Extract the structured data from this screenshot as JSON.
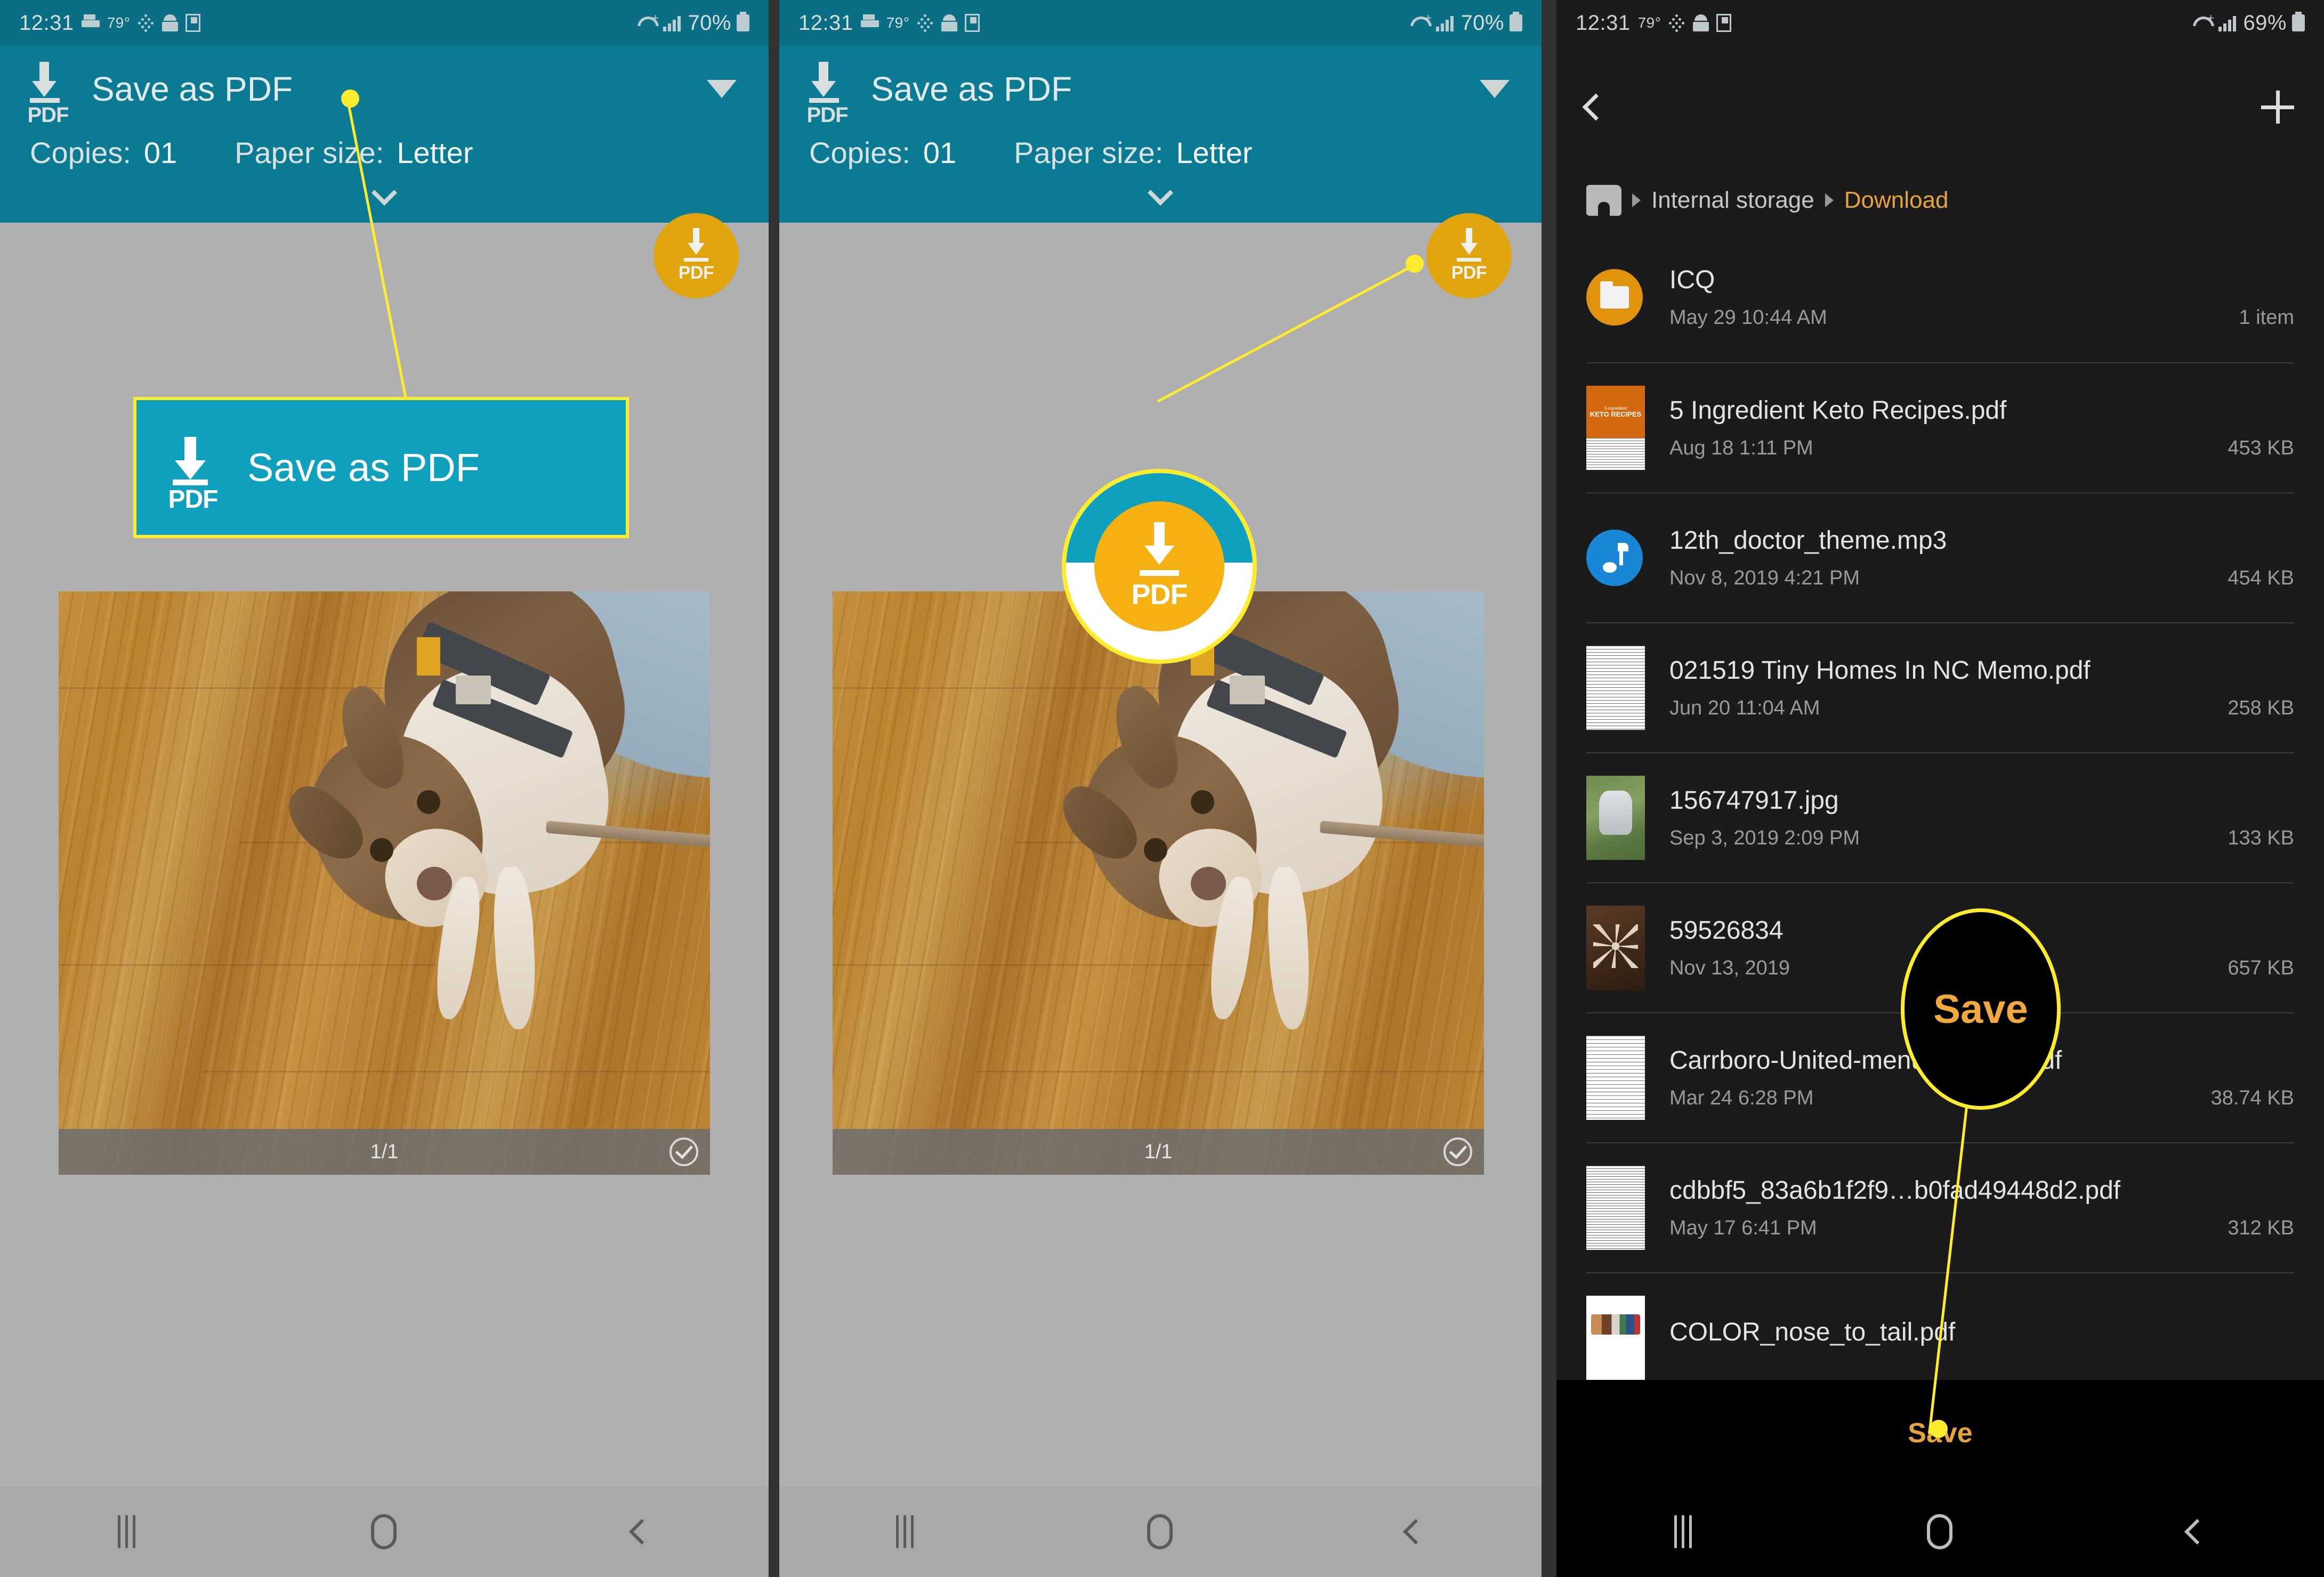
{
  "panels": {
    "panel1": {
      "status": {
        "time": "12:31",
        "temp": "79°",
        "battery": "70%",
        "icons": [
          "printer-icon",
          "temperature-icon",
          "dots-icon",
          "android-icon",
          "flipboard-icon",
          "wifi-icon",
          "signal-icon",
          "battery-icon"
        ]
      },
      "print": {
        "printer_label": "Save as PDF",
        "pdf_icon_label": "PDF",
        "copies_label": "Copies:",
        "copies_value": "01",
        "paper_label": "Paper size:",
        "paper_value": "Letter"
      },
      "preview": {
        "page_indicator": "1/1"
      },
      "annotation": {
        "box_label": "Save as PDF",
        "box_icon_label": "PDF"
      }
    },
    "panel2": {
      "status": {
        "time": "12:31",
        "temp": "79°",
        "battery": "70%"
      },
      "print": {
        "printer_label": "Save as PDF",
        "pdf_icon_label": "PDF",
        "copies_label": "Copies:",
        "copies_value": "01",
        "paper_label": "Paper size:",
        "paper_value": "Letter"
      },
      "preview": {
        "page_indicator": "1/1"
      },
      "fab_label": "PDF",
      "annotation": {
        "circle_icon_label": "PDF"
      }
    },
    "panel3": {
      "status": {
        "time": "12:31",
        "temp": "79°",
        "battery": "69%"
      },
      "breadcrumb": {
        "home": "home-icon",
        "parent": "Internal storage",
        "current": "Download"
      },
      "files": [
        {
          "name": "ICQ",
          "date": "May 29 10:44 AM",
          "size": "1 item",
          "kind": "folder"
        },
        {
          "name": "5 Ingredient Keto Recipes.pdf",
          "date": "Aug 18 1:11 PM",
          "size": "453 KB",
          "kind": "pdf-keto",
          "thumb_sub": "5-ingredient",
          "thumb_title": "KETO RECIPES"
        },
        {
          "name": "12th_doctor_theme.mp3",
          "date": "Nov 8, 2019 4:21 PM",
          "size": "454 KB",
          "kind": "audio"
        },
        {
          "name": "021519 Tiny Homes In NC Memo.pdf",
          "date": "Jun 20 11:04 AM",
          "size": "258 KB",
          "kind": "doc"
        },
        {
          "name": "156747917.jpg",
          "date": "Sep 3, 2019 2:09 PM",
          "size": "133 KB",
          "kind": "photo1"
        },
        {
          "name": "59526834",
          "date": "Nov 13, 2019",
          "size": "657 KB",
          "kind": "photo2"
        },
        {
          "name": "Carrboro-United-menu-3.24.20.pdf",
          "date": "Mar 24 6:28 PM",
          "size": "38.74 KB",
          "kind": "doc2"
        },
        {
          "name": "cdbbf5_83a6b1f2f9…b0fad49448d2.pdf",
          "date": "May 17 6:41 PM",
          "size": "312 KB",
          "kind": "doc3"
        },
        {
          "name": "COLOR_nose_to_tail.pdf",
          "date": "",
          "size": "",
          "kind": "cows"
        }
      ],
      "save_label": "Save",
      "annotation": {
        "oval_label": "Save"
      }
    }
  },
  "nav": {
    "recents": "recents-icon",
    "home": "home-button-icon",
    "back": "back-icon"
  },
  "colors": {
    "teal": "#0a7b92",
    "teal_dark": "#0a6e84",
    "accent_yellow": "#ffec2e",
    "amber": "#e2930e",
    "orange_text": "#e8a33c",
    "dark_bg": "#1b1b1b",
    "grey_bg": "#b0b0b0"
  }
}
